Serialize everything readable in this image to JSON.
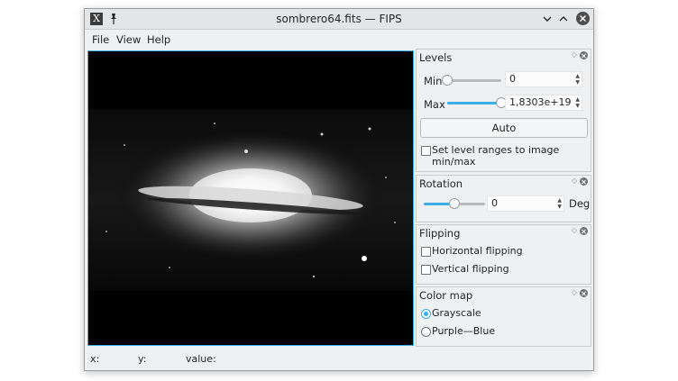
{
  "window": {
    "title": "sombrero64.fits — FIPS",
    "app_icon_glyph": "X"
  },
  "menu": [
    "File",
    "View",
    "Help"
  ],
  "levels": {
    "title": "Levels",
    "min_label": "Min",
    "min_value": "0",
    "min_fraction": 0.0,
    "max_label": "Max",
    "max_value": "1,8303e+19",
    "max_fraction": 1.0,
    "auto_label": "Auto",
    "range_checkbox_label": "Set level ranges to image min/max",
    "range_checked": false
  },
  "rotation": {
    "title": "Rotation",
    "value": "0",
    "fraction": 0.5,
    "unit": "Deg"
  },
  "flipping": {
    "title": "Flipping",
    "horizontal_label": "Horizontal flipping",
    "horizontal_checked": false,
    "vertical_label": "Vertical flipping",
    "vertical_checked": false
  },
  "colormap": {
    "title": "Color map",
    "options": [
      {
        "label": "Grayscale",
        "selected": true
      },
      {
        "label": "Purple—Blue",
        "selected": false
      }
    ]
  },
  "status": {
    "x_label": "x:",
    "y_label": "y:",
    "value_label": "value:"
  },
  "colors": {
    "accent": "#3daee9",
    "window_bg": "#eff0f1"
  },
  "icons": {
    "pin": "pin-icon",
    "minimize": "chevron-down-icon",
    "maximize": "chevron-up-icon",
    "close": "close-icon",
    "float": "float-icon",
    "panel_close": "close-small-icon"
  }
}
